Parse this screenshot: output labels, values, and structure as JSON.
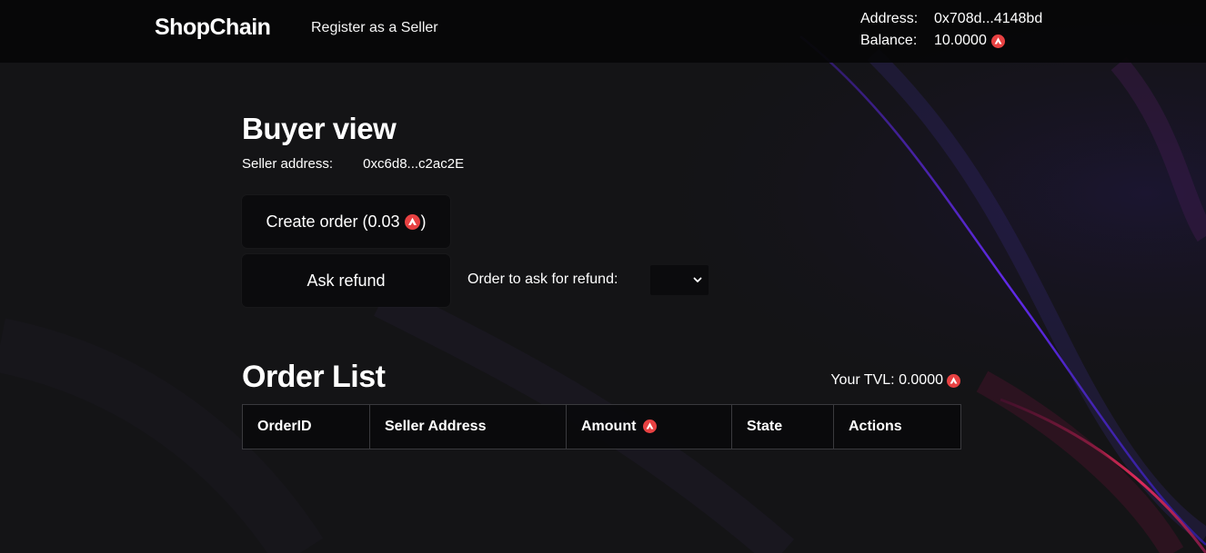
{
  "navbar": {
    "brand": "ShopChain",
    "register_link": "Register as a Seller",
    "address_label": "Address:",
    "address_value": "0x708d...4148bd",
    "balance_label": "Balance:",
    "balance_value": "10.0000"
  },
  "buyer": {
    "title": "Buyer view",
    "seller_label": "Seller address:",
    "seller_value": "0xc6d8...c2ac2E",
    "create_order_label": "Create order (0.03",
    "create_order_suffix": ")",
    "ask_refund_label": "Ask refund",
    "refund_select_label": "Order to ask for refund:",
    "refund_select_value": ""
  },
  "order_list": {
    "title": "Order List",
    "tvl_label": "Your TVL: 0.0000",
    "columns": [
      "OrderID",
      "Seller Address",
      "Amount",
      "State",
      "Actions"
    ],
    "rows": []
  },
  "icons": {
    "currency": "avalanche-icon",
    "select_arrow": "chevron-down-icon"
  },
  "colors": {
    "background": "#141416",
    "navbar": "#060608",
    "button": "#0b0b0d",
    "avax_red": "#e84142",
    "accent_purple": "#7b3cff",
    "accent_pink": "#ff2e63"
  }
}
